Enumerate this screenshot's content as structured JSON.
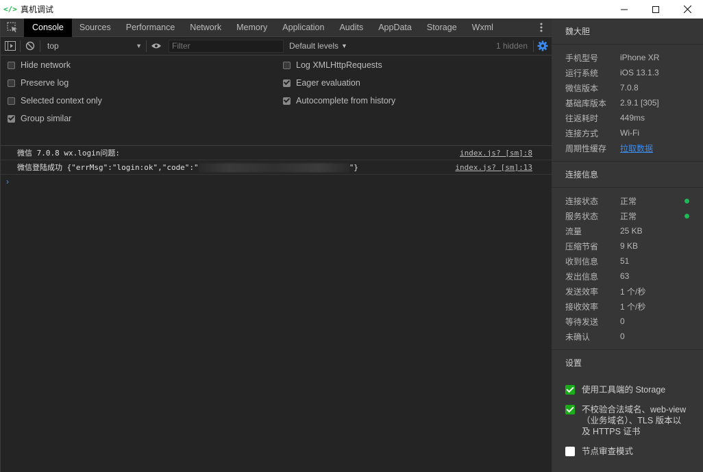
{
  "window": {
    "icon_text": "</>",
    "title": "真机调试"
  },
  "devtools": {
    "tabs": [
      "Console",
      "Sources",
      "Performance",
      "Network",
      "Memory",
      "Application",
      "Audits",
      "AppData",
      "Storage",
      "Wxml"
    ],
    "active_tab": "Console",
    "toolbar": {
      "context": "top",
      "filter_placeholder": "Filter",
      "levels": "Default levels",
      "hidden": "1 hidden"
    },
    "settings": {
      "left": [
        {
          "label": "Hide network",
          "checked": false
        },
        {
          "label": "Preserve log",
          "checked": false
        },
        {
          "label": "Selected context only",
          "checked": false
        },
        {
          "label": "Group similar",
          "checked": true
        }
      ],
      "right": [
        {
          "label": "Log XMLHttpRequests",
          "checked": false
        },
        {
          "label": "Eager evaluation",
          "checked": true
        },
        {
          "label": "Autocomplete from history",
          "checked": true
        }
      ]
    },
    "logs": [
      {
        "text": "微信 7.0.8 wx.login问题:",
        "source": "index.js? [sm]:8"
      },
      {
        "prefix": "微信登陆成功 {\"errMsg\":\"login:ok\",\"code\":\"",
        "suffix": "\"}",
        "source": "index.js? [sm]:13"
      }
    ],
    "prompt": "›"
  },
  "panel": {
    "user": "魏大胆",
    "device": [
      {
        "k": "手机型号",
        "v": "iPhone XR"
      },
      {
        "k": "运行系统",
        "v": "iOS 13.1.3"
      },
      {
        "k": "微信版本",
        "v": "7.0.8"
      },
      {
        "k": "基础库版本",
        "v": "2.9.1 [305]"
      },
      {
        "k": "往返耗时",
        "v": "449ms"
      },
      {
        "k": "连接方式",
        "v": "Wi-Fi"
      },
      {
        "k": "周期性缓存",
        "v": "拉取数据"
      }
    ],
    "conn_title": "连接信息",
    "conn": [
      {
        "k": "连接状态",
        "v": "正常"
      },
      {
        "k": "服务状态",
        "v": "正常"
      },
      {
        "k": "流量",
        "v": "25 KB"
      },
      {
        "k": "压缩节省",
        "v": "9 KB"
      },
      {
        "k": "收到信息",
        "v": "51"
      },
      {
        "k": "发出信息",
        "v": "63"
      },
      {
        "k": "发送效率",
        "v": "1 个/秒"
      },
      {
        "k": "接收效率",
        "v": "1 个/秒"
      },
      {
        "k": "等待发送",
        "v": "0"
      },
      {
        "k": "未确认",
        "v": "0"
      }
    ],
    "settings_title": "设置",
    "options": [
      {
        "label": "使用工具端的 Storage",
        "checked": true
      },
      {
        "label": "不校验合法域名、web-view（业务域名）、TLS 版本以及 HTTPS 证书",
        "checked": true
      },
      {
        "label": "节点审查模式",
        "checked": false
      }
    ],
    "status_color": "#1db954"
  }
}
